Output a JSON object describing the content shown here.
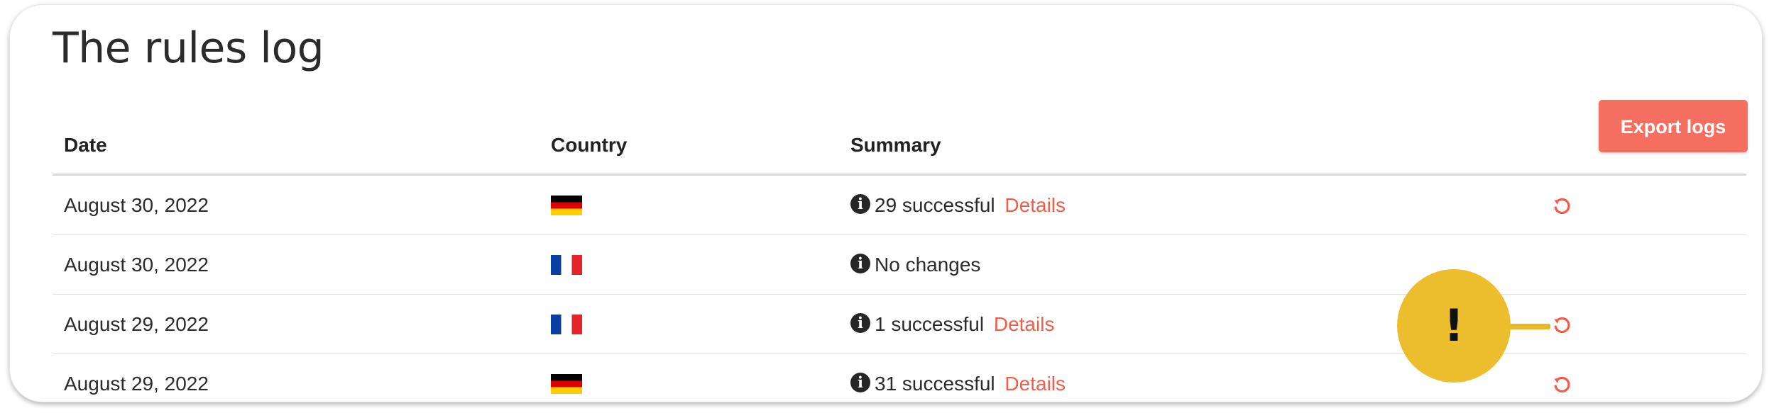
{
  "page": {
    "title": "The rules log"
  },
  "toolbar": {
    "export_label": "Export logs"
  },
  "table": {
    "headers": {
      "date": "Date",
      "country": "Country",
      "summary": "Summary"
    },
    "rows": [
      {
        "date": "August 30, 2022",
        "country_flag": "germany-flag",
        "summary": "29 successful",
        "details": "Details",
        "has_undo": true
      },
      {
        "date": "August 30, 2022",
        "country_flag": "france-flag",
        "summary": "No changes",
        "details": "",
        "has_undo": false
      },
      {
        "date": "August 29, 2022",
        "country_flag": "france-flag",
        "summary": "1 successful",
        "details": "Details",
        "has_undo": true
      },
      {
        "date": "August 29, 2022",
        "country_flag": "germany-flag",
        "summary": "31 successful",
        "details": "Details",
        "has_undo": true
      }
    ]
  },
  "callout": {
    "symbol": "!"
  },
  "colors": {
    "accent": "#f46f60",
    "link": "#f25c4b",
    "callout": "#ecbe2e"
  },
  "icons": {
    "info": "info-icon",
    "undo": "undo-icon"
  }
}
